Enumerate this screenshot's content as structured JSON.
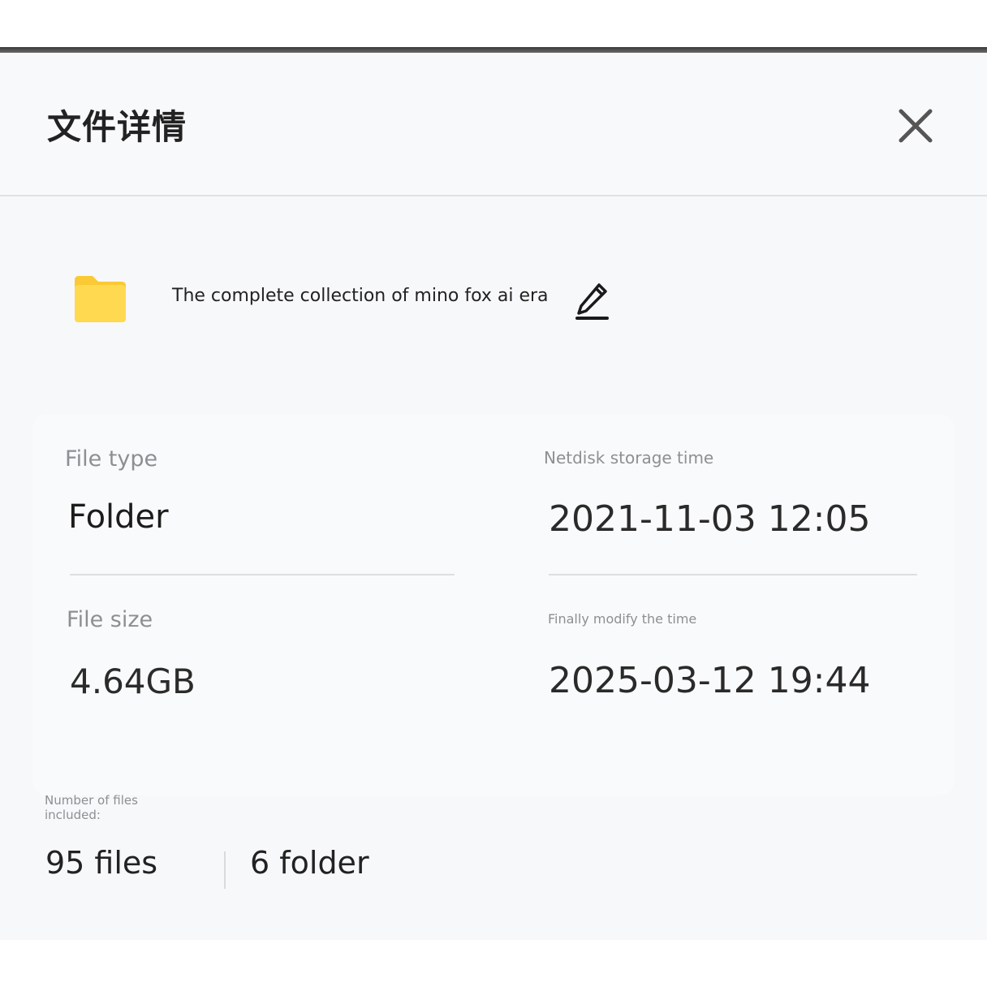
{
  "dialog": {
    "title": "文件详情",
    "close_icon": "close-icon"
  },
  "file": {
    "icon": "folder-icon",
    "icon_color": "#ffd54a",
    "name": "The complete collection of mino fox ai era",
    "edit_icon": "pencil-icon"
  },
  "details": {
    "file_type_label": "File type",
    "file_type_value": "Folder",
    "file_size_label": "File size",
    "file_size_value": "4.64GB",
    "storage_time_label": "Netdisk storage time",
    "storage_time_value": "2021-11-03 12:05",
    "modified_label": "Finally modify the time",
    "modified_value": "2025-03-12 19:44"
  },
  "counts": {
    "label": "Number of files included:",
    "files": "95 files",
    "folders": "6 folder"
  }
}
